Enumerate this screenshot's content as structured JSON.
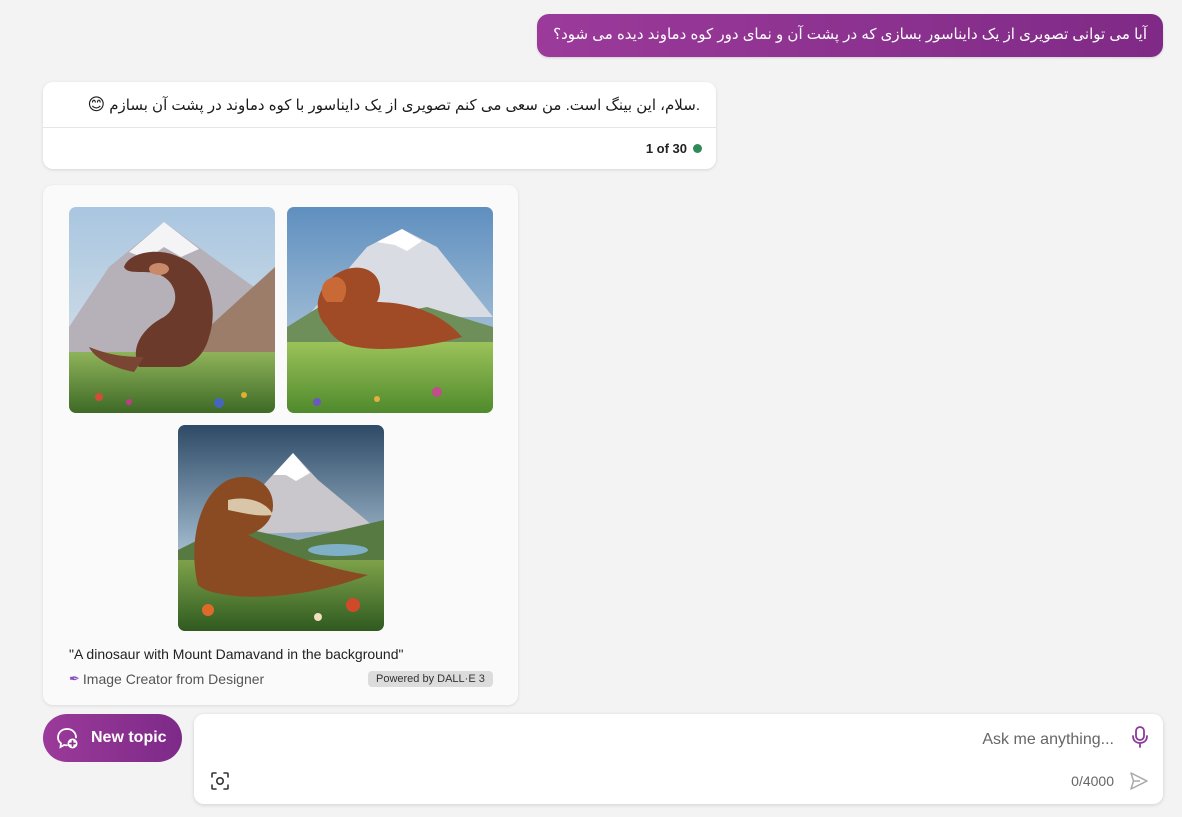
{
  "user_message": "آیا می توانی تصویری از یک دایناسور بسازی که در پشت آن و نمای دور کوه دماوند دیده می شود؟",
  "bot_reply": {
    "text": ".سلام، این بینگ است. من سعی می کنم تصویری از یک دایناسور با کوه دماوند در پشت آن بسازم",
    "emoji": "😊",
    "counter": "1 of 30",
    "status_color": "#2e8b57"
  },
  "image_card": {
    "caption": "\"A dinosaur with Mount Damavand in the background\"",
    "creator": "Image Creator from Designer",
    "powered_by": "Powered by DALL·E 3"
  },
  "composer": {
    "new_topic_label": "New topic",
    "placeholder": "Ask me anything...",
    "char_count": "0/4000"
  },
  "colors": {
    "accent_gradient_start": "#9b3a9a",
    "accent_gradient_end": "#7d2a88",
    "background": "#f3f3f3"
  }
}
